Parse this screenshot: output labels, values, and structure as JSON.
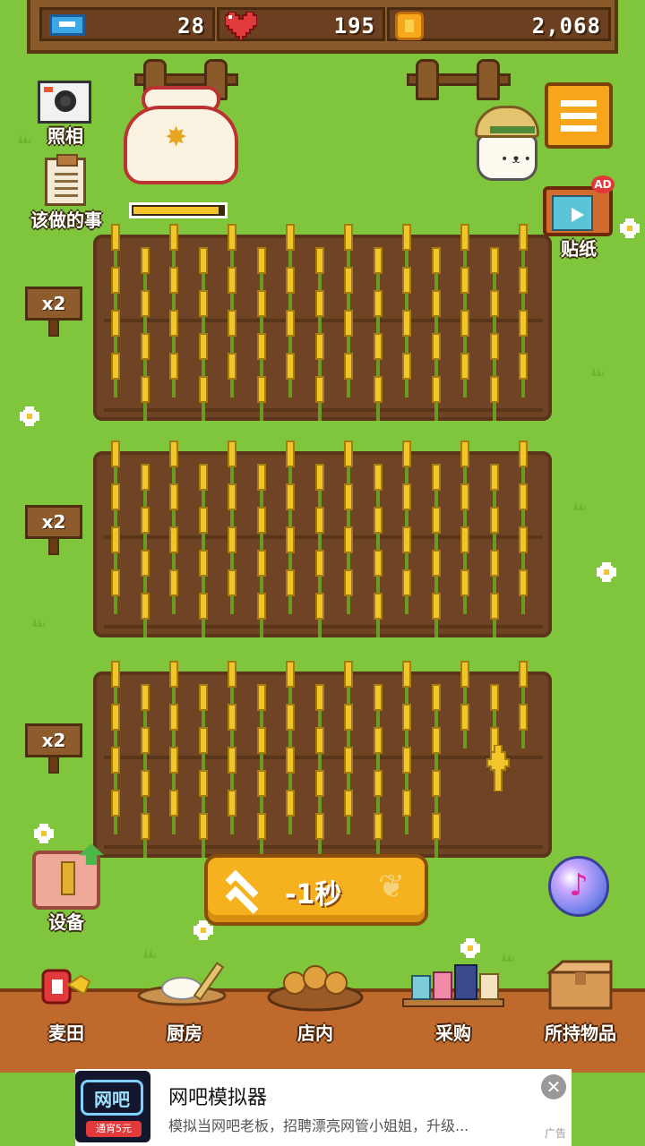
{
  "stats": {
    "tickets": "28",
    "hearts": "195",
    "coins": "2,068"
  },
  "side_buttons": {
    "camera_label": "照相",
    "todo_label": "该做的事",
    "sticker_label": "贴纸",
    "equipment_label": "设备"
  },
  "tv_badge": "AD",
  "sack_progress": 0.95,
  "fields": [
    {
      "multiplier": "x2"
    },
    {
      "multiplier": "x2"
    },
    {
      "multiplier": "x2"
    }
  ],
  "boost": {
    "label": "-1秒"
  },
  "bottom_nav": [
    {
      "label": "麦田"
    },
    {
      "label": "厨房"
    },
    {
      "label": "店内"
    },
    {
      "label": "采购"
    },
    {
      "label": "所持物品"
    }
  ],
  "ad": {
    "title": "网吧模拟器",
    "description": "模拟当网吧老板，招聘漂亮网管小姐姐，升级...",
    "image_text": "网吧",
    "image_subtext": "通宵5元",
    "tag": "广告"
  },
  "colors": {
    "grass": "#80c63c",
    "soil": "#6e4425",
    "wheat": "#f2c52a",
    "button_orange": "#f6b21e"
  }
}
